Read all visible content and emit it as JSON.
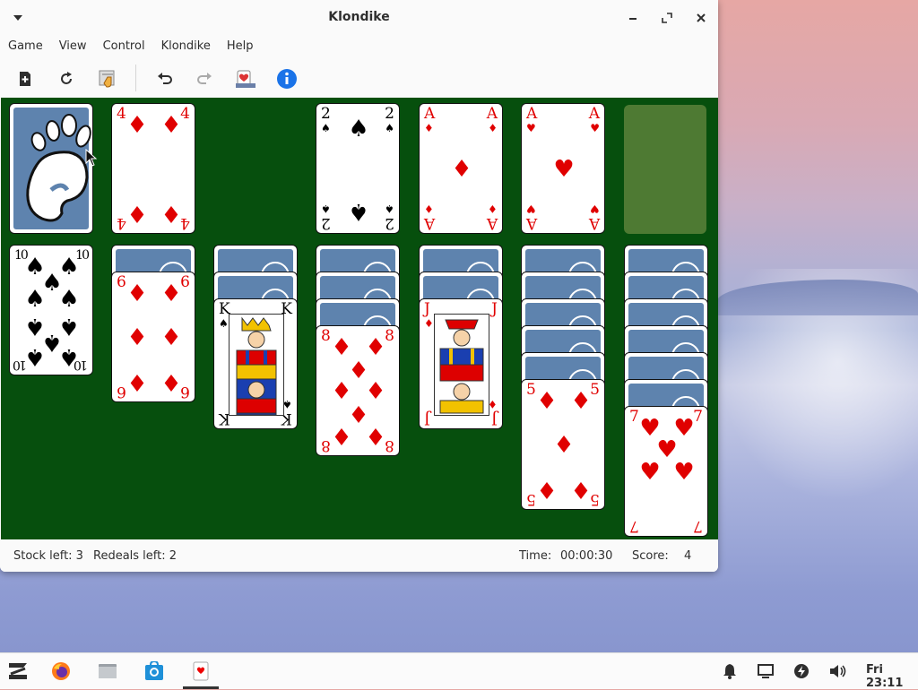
{
  "window": {
    "title": "Klondike",
    "menu": [
      "Game",
      "View",
      "Control",
      "Klondike",
      "Help"
    ]
  },
  "toolbar": {
    "icons": [
      "new-game-icon",
      "restart-icon",
      "select-game-icon",
      "undo-icon",
      "redo-icon",
      "deal-icon",
      "info-icon"
    ]
  },
  "stock": {
    "cards_shown": "back"
  },
  "waste": [
    {
      "rank": "4",
      "suit": "♦",
      "color": "red"
    }
  ],
  "foundations": [
    {
      "rank": "2",
      "suit": "♠",
      "color": "black"
    },
    {
      "rank": "A",
      "suit": "♦",
      "color": "red"
    },
    {
      "rank": "A",
      "suit": "♥",
      "color": "red"
    },
    {
      "rank": "",
      "suit": "",
      "color": ""
    }
  ],
  "tableau": [
    {
      "face_down": 0,
      "face_up": {
        "rank": "10",
        "suit": "♠",
        "color": "black"
      }
    },
    {
      "face_down": 1,
      "face_up": {
        "rank": "6",
        "suit": "♦",
        "color": "red"
      }
    },
    {
      "face_down": 2,
      "face_up": {
        "rank": "K",
        "suit": "♠",
        "color": "black"
      }
    },
    {
      "face_down": 3,
      "face_up": {
        "rank": "8",
        "suit": "♦",
        "color": "red"
      }
    },
    {
      "face_down": 2,
      "face_up": {
        "rank": "J",
        "suit": "♦",
        "color": "red"
      }
    },
    {
      "face_down": 5,
      "face_up": {
        "rank": "5",
        "suit": "♦",
        "color": "red"
      }
    },
    {
      "face_down": 6,
      "face_up": {
        "rank": "7",
        "suit": "♥",
        "color": "red"
      }
    }
  ],
  "status": {
    "stock_left": "Stock left: 3",
    "redeals_left": "Redeals left: 2",
    "time_label": "Time:",
    "time_value": "00:00:30",
    "score_label": "Score:",
    "score_value": "4"
  },
  "taskbar": {
    "clock": "Fri 23:11",
    "apps": [
      "zorin-menu-icon",
      "firefox-icon",
      "files-icon",
      "software-store-icon",
      "solitaire-icon"
    ]
  },
  "colors": {
    "felt": "#064f0d",
    "card_back": "#5e83ae",
    "empty_slot": "#4e7a33",
    "red_suit": "#e00000"
  }
}
